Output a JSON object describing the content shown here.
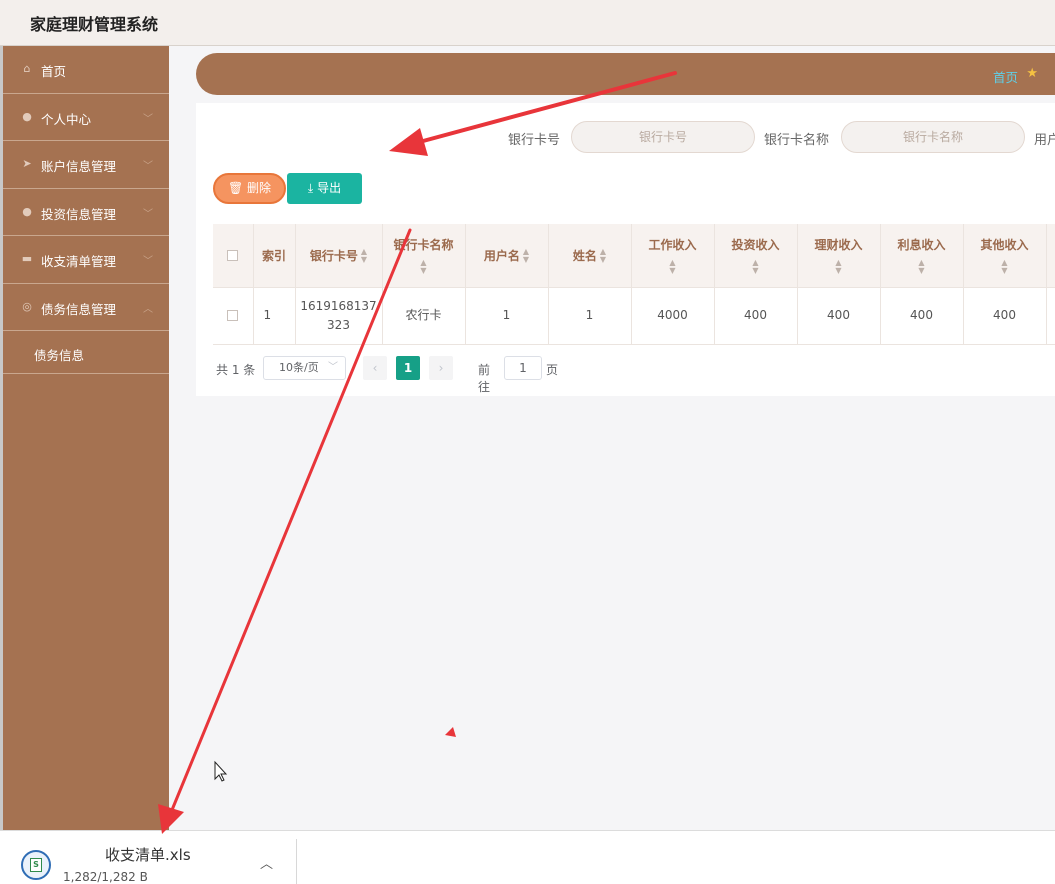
{
  "app": {
    "title": "家庭理财管理系统"
  },
  "sidebar": {
    "items": [
      {
        "label": "首页",
        "icon": "home-icon"
      },
      {
        "label": "个人中心",
        "icon": "user-icon"
      },
      {
        "label": "账户信息管理",
        "icon": "send-icon"
      },
      {
        "label": "投资信息管理",
        "icon": "location-icon"
      },
      {
        "label": "收支清单管理",
        "icon": "monitor-icon"
      },
      {
        "label": "债务信息管理",
        "icon": "globe-icon"
      }
    ],
    "submenu": {
      "label": "债务信息"
    }
  },
  "breadcrumb": {
    "home": "首页"
  },
  "search": {
    "card_no_label": "银行卡号",
    "card_no_placeholder": "银行卡号",
    "card_name_label": "银行卡名称",
    "card_name_placeholder": "银行卡名称",
    "username_label": "用户"
  },
  "toolbar": {
    "delete_label": "删除",
    "export_label": "导出"
  },
  "table": {
    "headers": [
      "索引",
      "银行卡号",
      "银行卡名称",
      "用户名",
      "姓名",
      "工作收入",
      "投资收入",
      "理财收入",
      "利息收入",
      "其他收入"
    ],
    "rows": [
      {
        "index": "1",
        "card_no_1": "1619168137",
        "card_no_2": "323",
        "card_name": "农行卡",
        "username": "1",
        "name": "1",
        "work_income": "4000",
        "invest_income": "400",
        "finance_income": "400",
        "interest_income": "400",
        "other_income": "400"
      }
    ]
  },
  "pagination": {
    "total": "共 1 条",
    "page_size": "10条/页",
    "current": "1",
    "goto_label": "前往",
    "goto_value": "1",
    "page_label": "页"
  },
  "download": {
    "filename": "收支清单.xls",
    "size": "1,282/1,282 B"
  },
  "colors": {
    "sidebar": "#a57251",
    "accent_green": "#16a087",
    "delete_orange": "#f59460",
    "annotation_red": "#e8353a"
  }
}
